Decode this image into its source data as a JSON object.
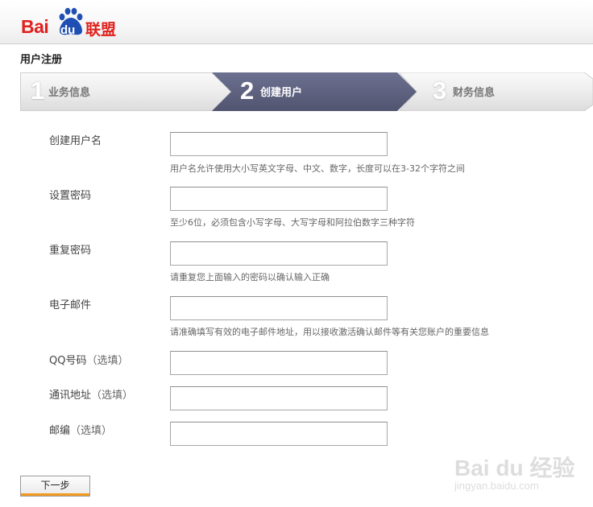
{
  "header": {
    "logo_bai": "Bai",
    "logo_du": "du",
    "logo_suffix": "联盟"
  },
  "page_title": "用户注册",
  "steps": [
    {
      "number": "1",
      "label": "业务信息",
      "active": false
    },
    {
      "number": "2",
      "label": "创建用户",
      "active": true
    },
    {
      "number": "3",
      "label": "财务信息",
      "active": false
    }
  ],
  "form": {
    "fields": [
      {
        "label": "创建用户名",
        "value": "",
        "hint": "用户名允许使用大小写英文字母、中文、数字，长度可以在3-32个字符之间"
      },
      {
        "label": "设置密码",
        "value": "",
        "hint": "至少6位，必须包含小写字母、大写字母和阿拉伯数字三种字符"
      },
      {
        "label": "重复密码",
        "value": "",
        "hint": "请重复您上面输入的密码以确认输入正确"
      },
      {
        "label": "电子邮件",
        "value": "",
        "hint": "请准确填写有效的电子邮件地址，用以接收激活确认邮件等有关您账户的重要信息"
      },
      {
        "label": "QQ号码",
        "optional": "（选填）",
        "value": ""
      },
      {
        "label": "通讯地址",
        "optional": "（选填）",
        "value": ""
      },
      {
        "label": "邮编",
        "optional": "（选填）",
        "value": ""
      }
    ],
    "next_button": "下一步"
  },
  "watermark": {
    "logo": "Bai du 经验",
    "url": "jingyan.baidu.com"
  },
  "colors": {
    "brand_red": "#e0211d",
    "active_step": "#5d6180",
    "button_accent": "#f39a1e"
  }
}
